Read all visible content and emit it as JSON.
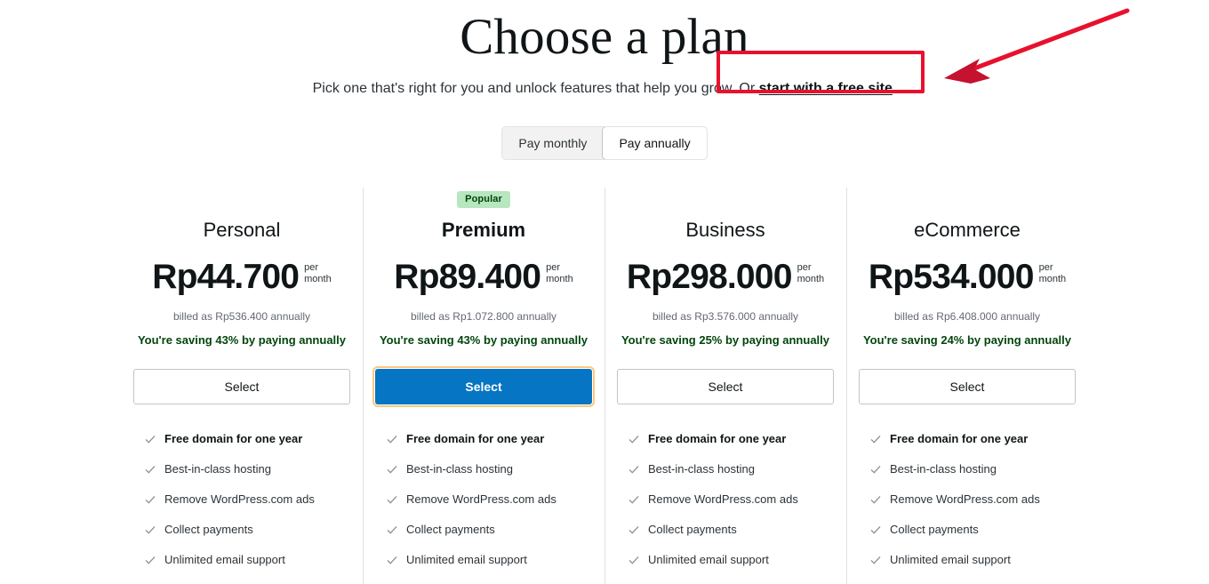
{
  "header": {
    "title": "Choose a plan",
    "subtitle_before": "Pick one that's right for you and unlock features that help you grow. Or ",
    "subtitle_link": "start with a free site",
    "subtitle_after": "."
  },
  "billing_toggle": {
    "monthly_label": "Pay monthly",
    "annual_label": "Pay annually",
    "selected": "Pay annually"
  },
  "colors": {
    "primary_button": "#0675c4",
    "badge_background": "#b8e6bf",
    "badge_text": "#00450c",
    "saving_text": "#00450c",
    "annotation": "#e8112d"
  },
  "plans": [
    {
      "badge": "",
      "name": "Personal",
      "price": "Rp44.700",
      "unit_line1": "per",
      "unit_line2": "month",
      "billed": "billed as Rp536.400 annually",
      "saving": "You're saving 43% by paying annually",
      "select_label": "Select",
      "features": [
        "Free domain for one year",
        "Best-in-class hosting",
        "Remove WordPress.com ads",
        "Collect payments",
        "Unlimited email support"
      ]
    },
    {
      "badge": "Popular",
      "name": "Premium",
      "price": "Rp89.400",
      "unit_line1": "per",
      "unit_line2": "month",
      "billed": "billed as Rp1.072.800 annually",
      "saving": "You're saving 43% by paying annually",
      "select_label": "Select",
      "features": [
        "Free domain for one year",
        "Best-in-class hosting",
        "Remove WordPress.com ads",
        "Collect payments",
        "Unlimited email support"
      ]
    },
    {
      "badge": "",
      "name": "Business",
      "price": "Rp298.000",
      "unit_line1": "per",
      "unit_line2": "month",
      "billed": "billed as Rp3.576.000 annually",
      "saving": "You're saving 25% by paying annually",
      "select_label": "Select",
      "features": [
        "Free domain for one year",
        "Best-in-class hosting",
        "Remove WordPress.com ads",
        "Collect payments",
        "Unlimited email support"
      ]
    },
    {
      "badge": "",
      "name": "eCommerce",
      "price": "Rp534.000",
      "unit_line1": "per",
      "unit_line2": "month",
      "billed": "billed as Rp6.408.000 annually",
      "saving": "You're saving 24% by paying annually",
      "select_label": "Select",
      "features": [
        "Free domain for one year",
        "Best-in-class hosting",
        "Remove WordPress.com ads",
        "Collect payments",
        "Unlimited email support"
      ]
    }
  ]
}
